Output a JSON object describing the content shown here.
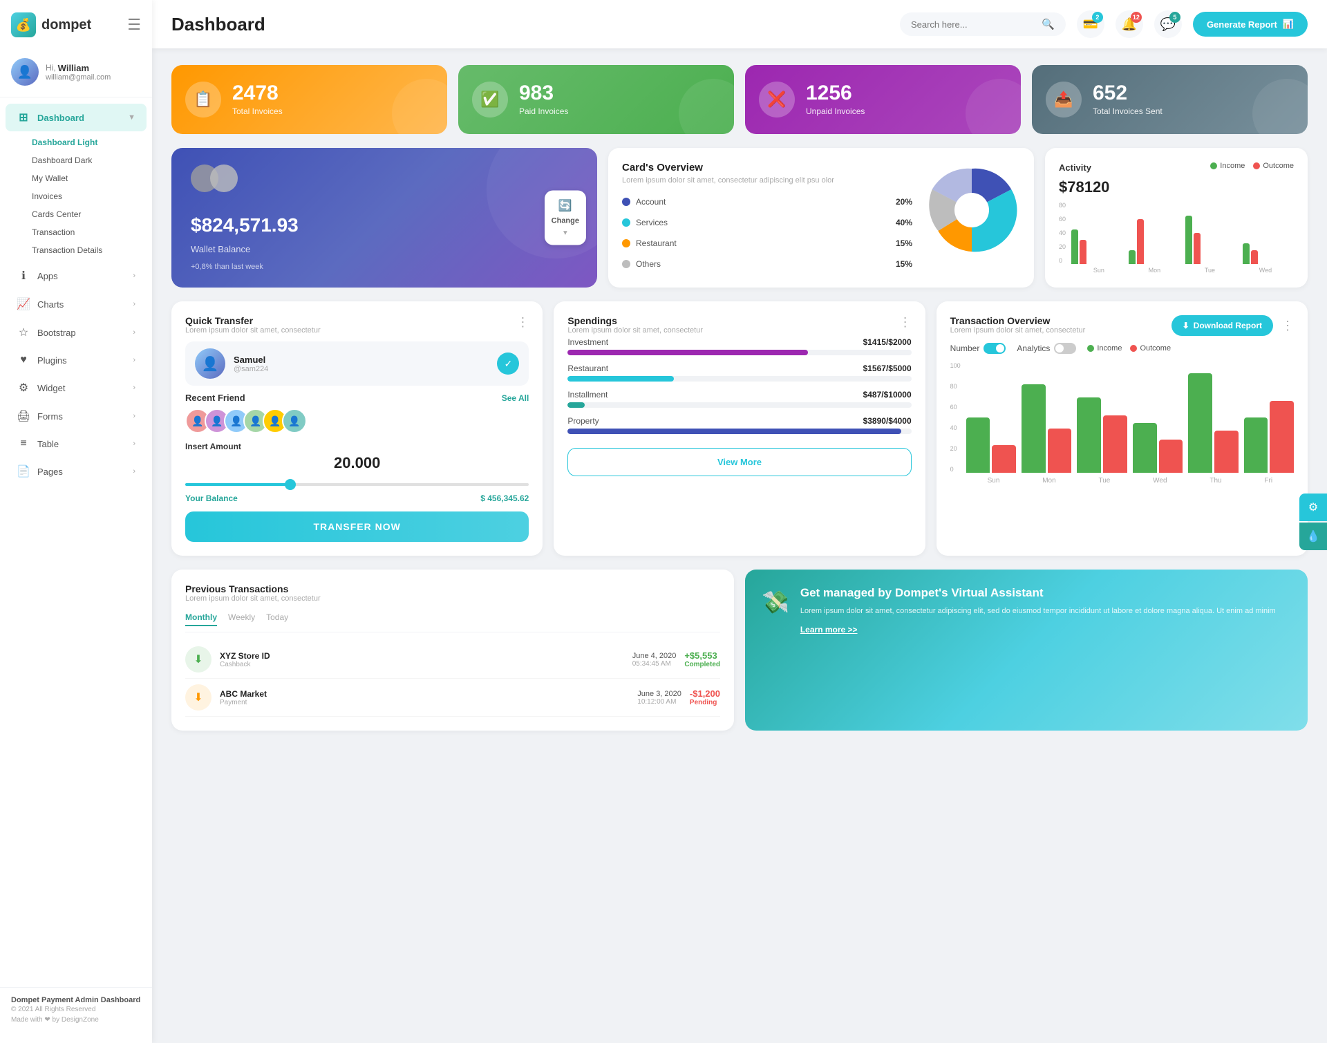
{
  "app": {
    "name": "dompet",
    "title": "Dashboard"
  },
  "user": {
    "greeting": "Hi,",
    "name": "William",
    "email": "william@gmail.com"
  },
  "header": {
    "search_placeholder": "Search here...",
    "generate_btn": "Generate Report",
    "badges": {
      "wallet": "2",
      "bell": "12",
      "chat": "5"
    }
  },
  "sidebar": {
    "dashboard_label": "Dashboard",
    "subitems": [
      {
        "label": "Dashboard Light"
      },
      {
        "label": "Dashboard Dark"
      },
      {
        "label": "My Wallet"
      },
      {
        "label": "Invoices"
      },
      {
        "label": "Cards Center"
      },
      {
        "label": "Transaction"
      },
      {
        "label": "Transaction Details"
      }
    ],
    "items": [
      {
        "label": "Apps"
      },
      {
        "label": "Charts"
      },
      {
        "label": "Bootstrap"
      },
      {
        "label": "Plugins"
      },
      {
        "label": "Widget"
      },
      {
        "label": "Forms"
      },
      {
        "label": "Table"
      },
      {
        "label": "Pages"
      }
    ],
    "footer_title": "Dompet Payment Admin Dashboard",
    "footer_copy": "© 2021 All Rights Reserved",
    "footer_made": "Made with ❤ by DesignZone"
  },
  "stats": [
    {
      "number": "2478",
      "label": "Total Invoices",
      "icon": "📋",
      "color": "orange"
    },
    {
      "number": "983",
      "label": "Paid Invoices",
      "icon": "✅",
      "color": "green"
    },
    {
      "number": "1256",
      "label": "Unpaid Invoices",
      "icon": "❌",
      "color": "purple"
    },
    {
      "number": "652",
      "label": "Total Invoices Sent",
      "icon": "📤",
      "color": "teal"
    }
  ],
  "wallet": {
    "amount": "$824,571.93",
    "label": "Wallet Balance",
    "change": "+0,8% than last week",
    "change_btn": "Change"
  },
  "card_overview": {
    "title": "Card's Overview",
    "desc": "Lorem ipsum dolor sit amet, consectetur adipiscing elit psu olor",
    "items": [
      {
        "name": "Account",
        "pct": "20%",
        "color": "#3f51b5"
      },
      {
        "name": "Services",
        "pct": "40%",
        "color": "#26c6da"
      },
      {
        "name": "Restaurant",
        "pct": "15%",
        "color": "#ff9800"
      },
      {
        "name": "Others",
        "pct": "15%",
        "color": "#bdbdbd"
      }
    ]
  },
  "activity": {
    "title": "Activity",
    "amount": "$78120",
    "legend": [
      {
        "label": "Income",
        "color": "#4caf50"
      },
      {
        "label": "Outcome",
        "color": "#ef5350"
      }
    ],
    "bars": [
      {
        "day": "Sun",
        "income": 50,
        "outcome": 35
      },
      {
        "day": "Mon",
        "income": 20,
        "outcome": 65
      },
      {
        "day": "Tue",
        "income": 70,
        "outcome": 45
      },
      {
        "day": "Wed",
        "income": 30,
        "outcome": 20
      }
    ],
    "y_labels": [
      "80",
      "60",
      "40",
      "20",
      "0"
    ]
  },
  "quick_transfer": {
    "title": "Quick Transfer",
    "desc": "Lorem ipsum dolor sit amet, consectetur",
    "user_name": "Samuel",
    "user_handle": "@sam224",
    "recent_label": "Recent Friend",
    "see_all": "See All",
    "insert_label": "Insert Amount",
    "amount": "20.000",
    "balance_label": "Your Balance",
    "balance_amount": "$ 456,345.62",
    "btn_label": "TRANSFER NOW"
  },
  "spendings": {
    "title": "Spendings",
    "desc": "Lorem ipsum dolor sit amet, consectetur",
    "items": [
      {
        "name": "Investment",
        "amount": "$1415",
        "max": "$2000",
        "pct": 70,
        "color": "#9c27b0"
      },
      {
        "name": "Restaurant",
        "amount": "$1567",
        "max": "$5000",
        "pct": 31,
        "color": "#26c6da"
      },
      {
        "name": "Installment",
        "amount": "$487",
        "max": "$10000",
        "pct": 5,
        "color": "#26a69a"
      },
      {
        "name": "Property",
        "amount": "$3890",
        "max": "$4000",
        "pct": 97,
        "color": "#3f51b5"
      }
    ],
    "view_more": "View More"
  },
  "transaction_overview": {
    "title": "Transaction Overview",
    "desc": "Lorem ipsum dolor sit amet, consectetur",
    "toggle1_label": "Number",
    "toggle2_label": "Analytics",
    "download_btn": "Download Report",
    "legend": [
      {
        "label": "Income",
        "color": "#4caf50"
      },
      {
        "label": "Outcome",
        "color": "#ef5350"
      }
    ],
    "bars": [
      {
        "day": "Sun",
        "income": 50,
        "outcome": 25
      },
      {
        "day": "Mon",
        "income": 80,
        "outcome": 40
      },
      {
        "day": "Tue",
        "income": 68,
        "outcome": 52
      },
      {
        "day": "Wed",
        "income": 45,
        "outcome": 30
      },
      {
        "day": "Thu",
        "income": 90,
        "outcome": 38
      },
      {
        "day": "Fri",
        "income": 50,
        "outcome": 65
      }
    ],
    "y_labels": [
      "100",
      "80",
      "60",
      "40",
      "20",
      "0"
    ]
  },
  "prev_transactions": {
    "title": "Previous Transactions",
    "desc": "Lorem ipsum dolor sit amet, consectetur",
    "tabs": [
      "Monthly",
      "Weekly",
      "Today"
    ],
    "active_tab": "Monthly",
    "items": [
      {
        "name": "XYZ Store ID",
        "type": "Cashback",
        "date": "June 4, 2020",
        "time": "05:34:45 AM",
        "amount": "+$5,553",
        "status": "Completed",
        "icon": "⬇",
        "icon_color": "green"
      }
    ]
  },
  "va_banner": {
    "title": "Get managed by Dompet's Virtual Assistant",
    "desc": "Lorem ipsum dolor sit amet, consectetur adipiscing elit, sed do eiusmod tempor incididunt ut labore et dolore magna aliqua. Ut enim ad minim",
    "link": "Learn more >>"
  }
}
